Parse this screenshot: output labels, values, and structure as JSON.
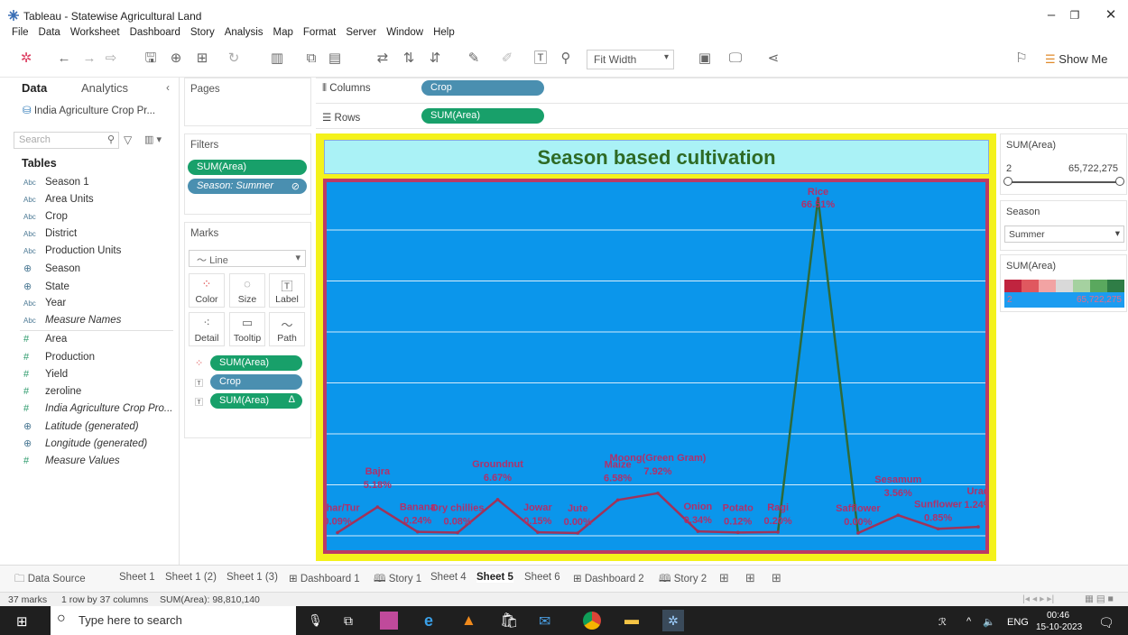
{
  "window": {
    "title": "Tableau - Statewise Agricultural Land"
  },
  "menu": [
    "File",
    "Data",
    "Worksheet",
    "Dashboard",
    "Story",
    "Analysis",
    "Map",
    "Format",
    "Server",
    "Window",
    "Help"
  ],
  "toolbar": {
    "fit": "Fit Width",
    "show_me": "Show Me"
  },
  "data_pane": {
    "tab_data": "Data",
    "tab_analytics": "Analytics",
    "datasource": "India Agriculture Crop Pr...",
    "search_placeholder": "Search",
    "tables_heading": "Tables",
    "fields": [
      {
        "type": "Abc",
        "name": "Season 1"
      },
      {
        "type": "Abc",
        "name": "Area Units"
      },
      {
        "type": "Abc",
        "name": "Crop"
      },
      {
        "type": "Abc",
        "name": "District"
      },
      {
        "type": "Abc",
        "name": "Production Units"
      },
      {
        "type": "geo",
        "name": "Season"
      },
      {
        "type": "geo",
        "name": "State"
      },
      {
        "type": "Abc",
        "name": "Year"
      },
      {
        "type": "Abc",
        "name": "Measure Names"
      },
      {
        "type": "#",
        "name": "Area"
      },
      {
        "type": "#",
        "name": "Production"
      },
      {
        "type": "#",
        "name": "Yield"
      },
      {
        "type": "#",
        "name": "zeroline"
      },
      {
        "type": "#",
        "name": "India Agriculture Crop Pro..."
      },
      {
        "type": "geo",
        "name": "Latitude (generated)"
      },
      {
        "type": "geo",
        "name": "Longitude (generated)"
      },
      {
        "type": "#",
        "name": "Measure Values"
      }
    ]
  },
  "cards": {
    "pages": "Pages",
    "filters": "Filters",
    "filter_pills": [
      "SUM(Area)",
      "Season: Summer"
    ],
    "marks": "Marks",
    "mark_type": "Line",
    "mark_buttons": [
      "Color",
      "Size",
      "Label",
      "Detail",
      "Tooltip",
      "Path"
    ],
    "mark_pills": [
      "SUM(Area)",
      "Crop",
      "SUM(Area)"
    ],
    "mark_pill_delta": "Δ"
  },
  "shelves": {
    "columns_label": "Columns",
    "columns_pill": "Crop",
    "rows_label": "Rows",
    "rows_pill": "SUM(Area)"
  },
  "view": {
    "title": "Season based cultivation"
  },
  "chart_data": {
    "type": "line",
    "title": "Season based cultivation",
    "series": [
      {
        "values": [
          0.09,
          5.18,
          0.24,
          0.08,
          6.67,
          0.15,
          0.0,
          6.58,
          7.92,
          0.34,
          0.12,
          0.2,
          66.51,
          0.0,
          3.56,
          0.85,
          1.24
        ]
      }
    ],
    "categories": [
      "Arhar/Tur",
      "Bajra",
      "Banana",
      "Dry chillies",
      "Groundnut",
      "Jowar",
      "Jute",
      "Maize",
      "Moong(Green Gram)",
      "Onion",
      "Potato",
      "Ragi",
      "Rice",
      "Safflower",
      "Sesamum",
      "Sunflower",
      "Urad"
    ],
    "labels": [
      "0.09%",
      "5.18%",
      "0.24%",
      "0.08%",
      "6.67%",
      "0.15%",
      "0.00%",
      "6.58%",
      "7.92%",
      "0.34%",
      "0.12%",
      "0.20%",
      "66.51%",
      "0.00%",
      "3.56%",
      "0.85%",
      "1.24%"
    ],
    "grid": true,
    "line_color": "#a0335a",
    "peak_color": "#2e6a3a",
    "background": "#0b96eb"
  },
  "legends": {
    "sum_area_title": "SUM(Area)",
    "range_min": "2",
    "range_max": "65,722,275",
    "season_title": "Season",
    "season_value": "Summer",
    "color_title": "SUM(Area)",
    "color_min": "2",
    "color_max": "65,722,275",
    "color_steps": [
      "#c0243f",
      "#e0585f",
      "#f2a3a3",
      "#d9d9d9",
      "#a5d1a0",
      "#5aa85e",
      "#2f7d46"
    ]
  },
  "sheets": [
    {
      "label": "Data Source",
      "active": false
    },
    {
      "label": "Sheet 1",
      "active": false
    },
    {
      "label": "Sheet 1 (2)",
      "active": false
    },
    {
      "label": "Sheet 1 (3)",
      "active": false
    },
    {
      "label": "Dashboard 1",
      "active": false
    },
    {
      "label": "Story 1",
      "active": false
    },
    {
      "label": "Sheet 4",
      "active": false
    },
    {
      "label": "Sheet 5",
      "active": true
    },
    {
      "label": "Sheet 6",
      "active": false
    },
    {
      "label": "Dashboard 2",
      "active": false
    },
    {
      "label": "Story 2",
      "active": false
    }
  ],
  "status": {
    "marks": "37 marks",
    "rowscols": "1 row by 37 columns",
    "sum": "SUM(Area): 98,810,140"
  },
  "taskbar": {
    "search": "Type here to search",
    "lang": "ENG",
    "time": "00:46",
    "date": "15-10-2023"
  }
}
